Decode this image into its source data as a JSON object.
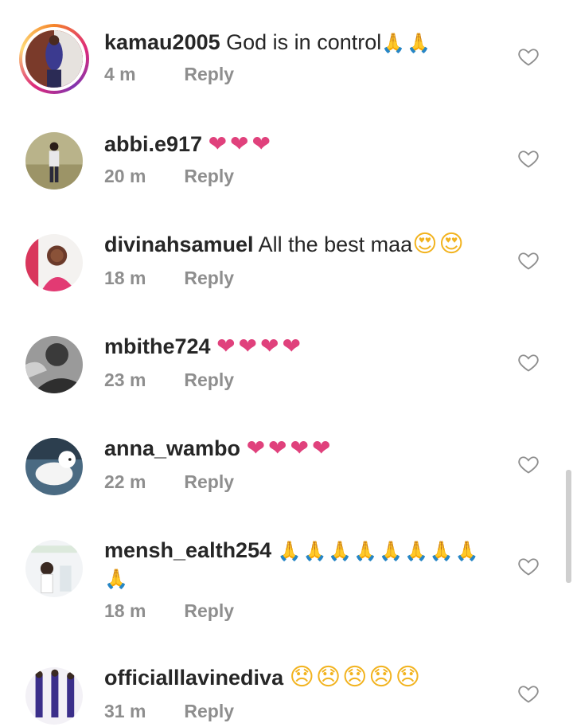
{
  "comments": [
    {
      "username": "kamau2005",
      "text": "God is in control",
      "emoji": "🙏🙏",
      "emoji_kind": "pray",
      "time": "4 m",
      "reply": "Reply",
      "icon": "heart-outline-icon"
    },
    {
      "username": "abbi.e917",
      "text": "",
      "emoji": "❤❤❤",
      "emoji_kind": "heart",
      "time": "20 m",
      "reply": "Reply",
      "icon": "heart-outline-icon"
    },
    {
      "username": "divinahsamuel",
      "text": "All the best maa",
      "emoji": "😍😍",
      "emoji_kind": "face",
      "time": "18 m",
      "reply": "Reply",
      "icon": "heart-outline-icon"
    },
    {
      "username": "mbithe724",
      "text": "",
      "emoji": "❤❤❤❤",
      "emoji_kind": "heart",
      "time": "23 m",
      "reply": "Reply",
      "icon": "heart-outline-icon"
    },
    {
      "username": "anna_wambo",
      "text": "",
      "emoji": "❤❤❤❤",
      "emoji_kind": "heart",
      "time": "22 m",
      "reply": "Reply",
      "icon": "heart-outline-icon"
    },
    {
      "username": "mensh_ealth254",
      "text": "",
      "emoji": "🙏🙏🙏🙏🙏🙏🙏🙏",
      "emoji_line2": "🙏",
      "emoji_kind": "pray",
      "time": "18 m",
      "reply": "Reply",
      "icon": "heart-outline-icon"
    },
    {
      "username": "officialllavinediva",
      "text": "",
      "emoji": "😞😞😞😞😞",
      "emoji_kind": "face",
      "time": "31 m",
      "reply": "Reply",
      "icon": "heart-outline-icon"
    }
  ],
  "colors": {
    "username": "#262626",
    "meta": "#8e8e8e",
    "heart_emoji": "#e0417c",
    "like_icon": "#8e8e8e"
  }
}
